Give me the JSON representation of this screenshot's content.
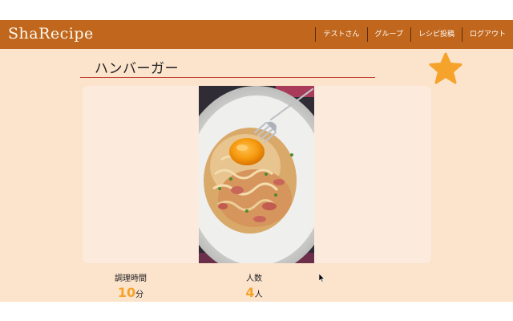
{
  "app": {
    "logo": "ShaRecipe"
  },
  "nav": {
    "items": [
      {
        "label": "テストさん"
      },
      {
        "label": "グループ"
      },
      {
        "label": "レシピ投稿"
      },
      {
        "label": "ログアウト"
      }
    ]
  },
  "recipe": {
    "title": "ハンバーガー",
    "favorite_icon": "star-icon",
    "colors": {
      "header": "#c0671d",
      "background": "#fbe3cc",
      "accent": "#f5a32a"
    },
    "stats": [
      {
        "label": "調理時間",
        "value": "10",
        "unit": "分"
      },
      {
        "label": "人数",
        "value": "4",
        "unit": "人"
      }
    ]
  }
}
